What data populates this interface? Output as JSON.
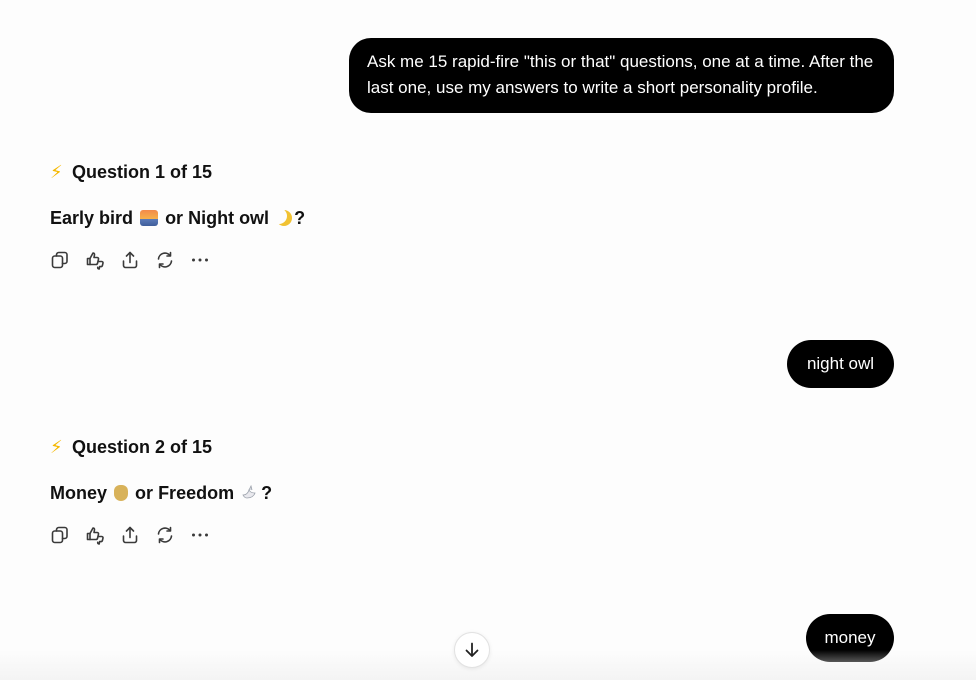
{
  "conversation": {
    "user_prompt": "Ask me 15 rapid-fire \"this or that\" questions, one at a time. After the last one, use my answers to write a short personality profile.",
    "questions": [
      {
        "heading_icon": "lightning-bolt-icon",
        "heading": "Question 1 of 15",
        "option_a": "Early bird",
        "option_a_icon": "sunrise-emoji",
        "connector": "or",
        "option_b": "Night owl",
        "option_b_icon": "crescent-moon-emoji",
        "suffix": "?"
      },
      {
        "heading_icon": "lightning-bolt-icon",
        "heading": "Question 2 of 15",
        "option_a": "Money",
        "option_a_icon": "money-bag-emoji",
        "connector": "or",
        "option_b": "Freedom",
        "option_b_icon": "dove-emoji",
        "suffix": "?"
      }
    ],
    "answers": [
      "night owl",
      "money"
    ]
  },
  "message_actions": [
    "copy-icon",
    "thumbs-up-down-icon",
    "share-icon",
    "regenerate-icon",
    "more-icon"
  ],
  "scroll_button_icon": "arrow-down-icon",
  "colors": {
    "user_bubble_bg": "#000000",
    "user_bubble_text": "#ffffff",
    "page_bg": "#fdfdfd",
    "bolt": "#f5b800"
  }
}
